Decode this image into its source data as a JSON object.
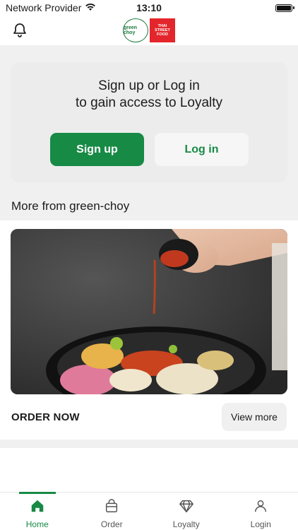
{
  "status_bar": {
    "carrier": "Network Provider",
    "time": "13:10",
    "battery_percent": 100
  },
  "header": {
    "notification_icon": "bell-icon",
    "logo_green_choy_text": "green choy",
    "logo_thai_street_food_text": "THAI STREET FOOD"
  },
  "auth": {
    "title_line1": "Sign up or Log in",
    "title_line2": "to gain access to Loyalty",
    "signup_label": "Sign up",
    "login_label": "Log in"
  },
  "section": {
    "title": "More from green-choy"
  },
  "promo": {
    "order_now_label": "ORDER NOW",
    "view_more_label": "View more"
  },
  "tabs": [
    {
      "label": "Home",
      "icon": "home-icon",
      "active": true
    },
    {
      "label": "Order",
      "icon": "bag-icon",
      "active": false
    },
    {
      "label": "Loyalty",
      "icon": "diamond-icon",
      "active": false
    },
    {
      "label": "Login",
      "icon": "user-icon",
      "active": false
    }
  ],
  "colors": {
    "brand_green": "#178a45",
    "accent_red": "#e3262b",
    "background": "#f0f0f0"
  }
}
